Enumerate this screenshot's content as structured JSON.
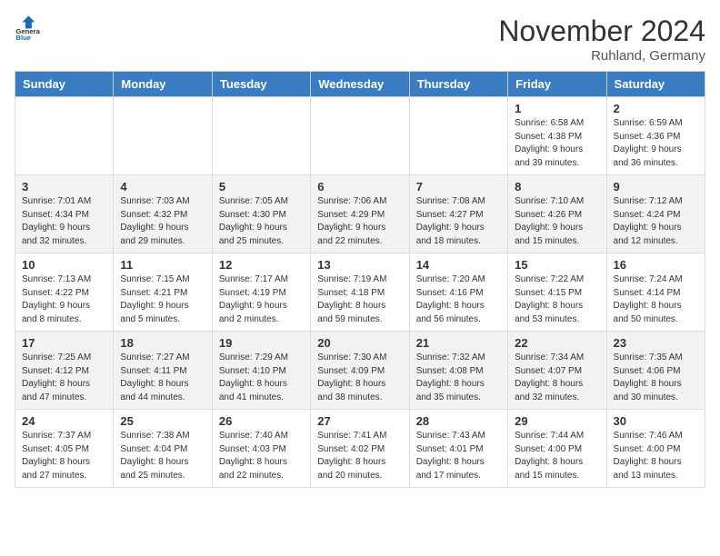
{
  "logo": {
    "line1": "General",
    "line2": "Blue"
  },
  "title": "November 2024",
  "location": "Ruhland, Germany",
  "weekdays": [
    "Sunday",
    "Monday",
    "Tuesday",
    "Wednesday",
    "Thursday",
    "Friday",
    "Saturday"
  ],
  "weeks": [
    [
      null,
      null,
      null,
      null,
      null,
      {
        "day": "1",
        "sunrise": "Sunrise: 6:58 AM",
        "sunset": "Sunset: 4:38 PM",
        "daylight": "Daylight: 9 hours and 39 minutes."
      },
      {
        "day": "2",
        "sunrise": "Sunrise: 6:59 AM",
        "sunset": "Sunset: 4:36 PM",
        "daylight": "Daylight: 9 hours and 36 minutes."
      }
    ],
    [
      {
        "day": "3",
        "sunrise": "Sunrise: 7:01 AM",
        "sunset": "Sunset: 4:34 PM",
        "daylight": "Daylight: 9 hours and 32 minutes."
      },
      {
        "day": "4",
        "sunrise": "Sunrise: 7:03 AM",
        "sunset": "Sunset: 4:32 PM",
        "daylight": "Daylight: 9 hours and 29 minutes."
      },
      {
        "day": "5",
        "sunrise": "Sunrise: 7:05 AM",
        "sunset": "Sunset: 4:30 PM",
        "daylight": "Daylight: 9 hours and 25 minutes."
      },
      {
        "day": "6",
        "sunrise": "Sunrise: 7:06 AM",
        "sunset": "Sunset: 4:29 PM",
        "daylight": "Daylight: 9 hours and 22 minutes."
      },
      {
        "day": "7",
        "sunrise": "Sunrise: 7:08 AM",
        "sunset": "Sunset: 4:27 PM",
        "daylight": "Daylight: 9 hours and 18 minutes."
      },
      {
        "day": "8",
        "sunrise": "Sunrise: 7:10 AM",
        "sunset": "Sunset: 4:26 PM",
        "daylight": "Daylight: 9 hours and 15 minutes."
      },
      {
        "day": "9",
        "sunrise": "Sunrise: 7:12 AM",
        "sunset": "Sunset: 4:24 PM",
        "daylight": "Daylight: 9 hours and 12 minutes."
      }
    ],
    [
      {
        "day": "10",
        "sunrise": "Sunrise: 7:13 AM",
        "sunset": "Sunset: 4:22 PM",
        "daylight": "Daylight: 9 hours and 8 minutes."
      },
      {
        "day": "11",
        "sunrise": "Sunrise: 7:15 AM",
        "sunset": "Sunset: 4:21 PM",
        "daylight": "Daylight: 9 hours and 5 minutes."
      },
      {
        "day": "12",
        "sunrise": "Sunrise: 7:17 AM",
        "sunset": "Sunset: 4:19 PM",
        "daylight": "Daylight: 9 hours and 2 minutes."
      },
      {
        "day": "13",
        "sunrise": "Sunrise: 7:19 AM",
        "sunset": "Sunset: 4:18 PM",
        "daylight": "Daylight: 8 hours and 59 minutes."
      },
      {
        "day": "14",
        "sunrise": "Sunrise: 7:20 AM",
        "sunset": "Sunset: 4:16 PM",
        "daylight": "Daylight: 8 hours and 56 minutes."
      },
      {
        "day": "15",
        "sunrise": "Sunrise: 7:22 AM",
        "sunset": "Sunset: 4:15 PM",
        "daylight": "Daylight: 8 hours and 53 minutes."
      },
      {
        "day": "16",
        "sunrise": "Sunrise: 7:24 AM",
        "sunset": "Sunset: 4:14 PM",
        "daylight": "Daylight: 8 hours and 50 minutes."
      }
    ],
    [
      {
        "day": "17",
        "sunrise": "Sunrise: 7:25 AM",
        "sunset": "Sunset: 4:12 PM",
        "daylight": "Daylight: 8 hours and 47 minutes."
      },
      {
        "day": "18",
        "sunrise": "Sunrise: 7:27 AM",
        "sunset": "Sunset: 4:11 PM",
        "daylight": "Daylight: 8 hours and 44 minutes."
      },
      {
        "day": "19",
        "sunrise": "Sunrise: 7:29 AM",
        "sunset": "Sunset: 4:10 PM",
        "daylight": "Daylight: 8 hours and 41 minutes."
      },
      {
        "day": "20",
        "sunrise": "Sunrise: 7:30 AM",
        "sunset": "Sunset: 4:09 PM",
        "daylight": "Daylight: 8 hours and 38 minutes."
      },
      {
        "day": "21",
        "sunrise": "Sunrise: 7:32 AM",
        "sunset": "Sunset: 4:08 PM",
        "daylight": "Daylight: 8 hours and 35 minutes."
      },
      {
        "day": "22",
        "sunrise": "Sunrise: 7:34 AM",
        "sunset": "Sunset: 4:07 PM",
        "daylight": "Daylight: 8 hours and 32 minutes."
      },
      {
        "day": "23",
        "sunrise": "Sunrise: 7:35 AM",
        "sunset": "Sunset: 4:06 PM",
        "daylight": "Daylight: 8 hours and 30 minutes."
      }
    ],
    [
      {
        "day": "24",
        "sunrise": "Sunrise: 7:37 AM",
        "sunset": "Sunset: 4:05 PM",
        "daylight": "Daylight: 8 hours and 27 minutes."
      },
      {
        "day": "25",
        "sunrise": "Sunrise: 7:38 AM",
        "sunset": "Sunset: 4:04 PM",
        "daylight": "Daylight: 8 hours and 25 minutes."
      },
      {
        "day": "26",
        "sunrise": "Sunrise: 7:40 AM",
        "sunset": "Sunset: 4:03 PM",
        "daylight": "Daylight: 8 hours and 22 minutes."
      },
      {
        "day": "27",
        "sunrise": "Sunrise: 7:41 AM",
        "sunset": "Sunset: 4:02 PM",
        "daylight": "Daylight: 8 hours and 20 minutes."
      },
      {
        "day": "28",
        "sunrise": "Sunrise: 7:43 AM",
        "sunset": "Sunset: 4:01 PM",
        "daylight": "Daylight: 8 hours and 17 minutes."
      },
      {
        "day": "29",
        "sunrise": "Sunrise: 7:44 AM",
        "sunset": "Sunset: 4:00 PM",
        "daylight": "Daylight: 8 hours and 15 minutes."
      },
      {
        "day": "30",
        "sunrise": "Sunrise: 7:46 AM",
        "sunset": "Sunset: 4:00 PM",
        "daylight": "Daylight: 8 hours and 13 minutes."
      }
    ]
  ]
}
